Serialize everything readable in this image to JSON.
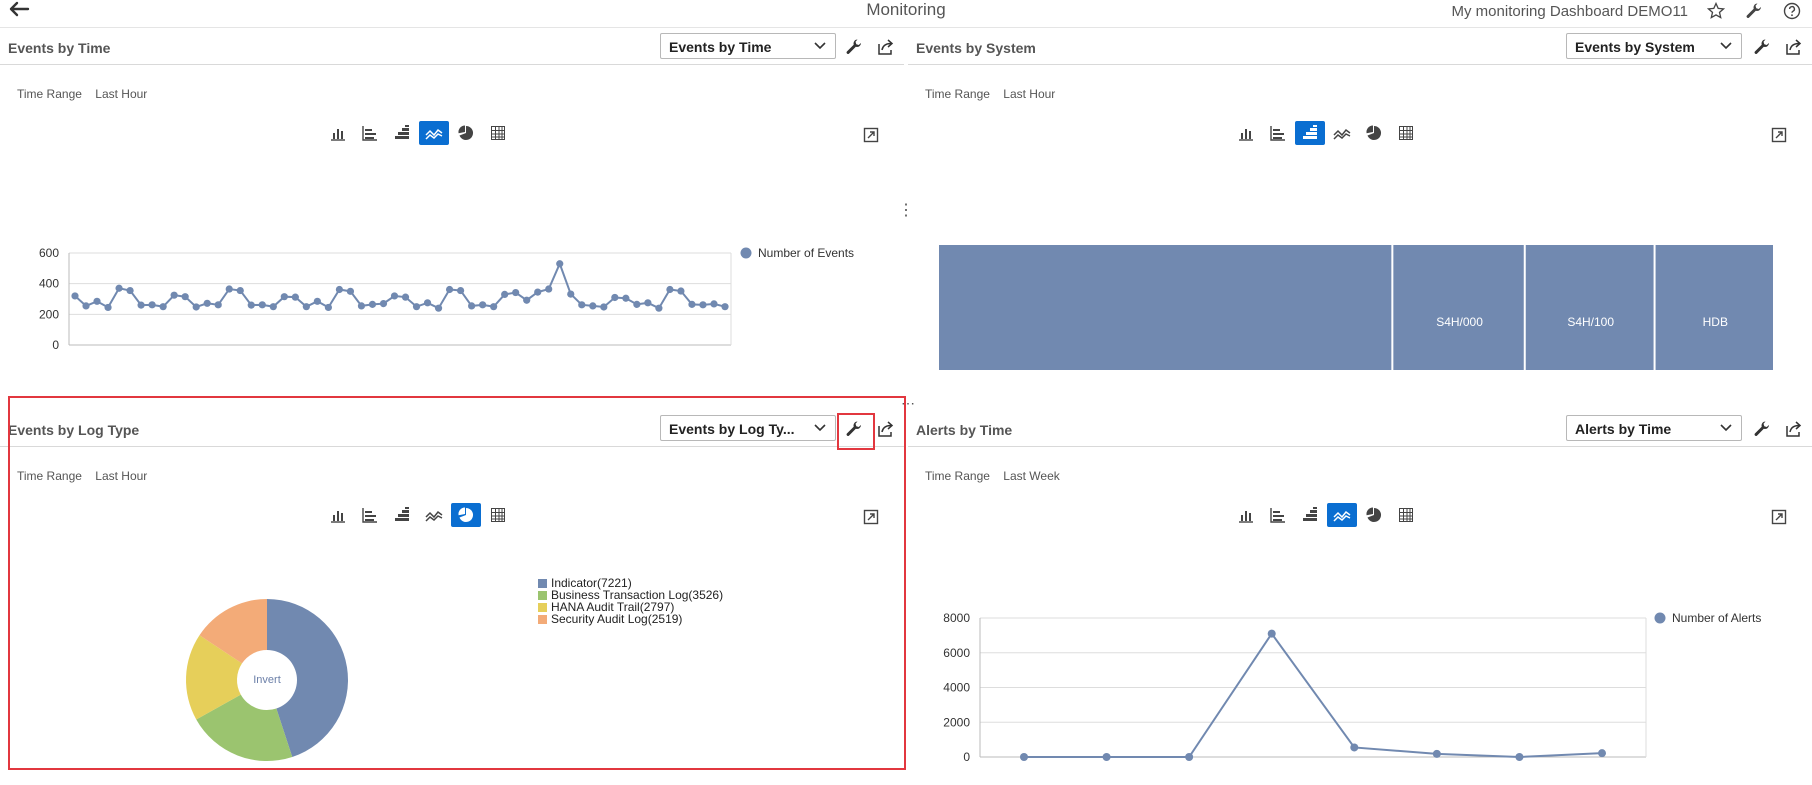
{
  "app": {
    "title": "Monitoring",
    "dashboard_name": "My monitoring Dashboard DEMO11",
    "icons": [
      "back-arrow-icon",
      "star-icon",
      "wrench-icon",
      "help-icon"
    ]
  },
  "panels": [
    {
      "title": "Events by Time",
      "select_value": "Events by Time",
      "time_range_label": "Time Range",
      "time_range_value": "Last Hour",
      "active_chart_type": "line"
    },
    {
      "title": "Events by System",
      "select_value": "Events by System",
      "time_range_label": "Time Range",
      "time_range_value": "Last Hour",
      "active_chart_type": "treemap"
    },
    {
      "title": "Events by Log Type",
      "select_value": "Events by Log Ty...",
      "time_range_label": "Time Range",
      "time_range_value": "Last Hour",
      "active_chart_type": "pie"
    },
    {
      "title": "Alerts by Time",
      "select_value": "Alerts by Time",
      "time_range_label": "Time Range",
      "time_range_value": "Last Week",
      "active_chart_type": "line"
    }
  ],
  "colors": {
    "accent": "#0a6ed1",
    "series": "#7189b0",
    "highlight": "#e2373f",
    "pie": [
      "#7189b0",
      "#9bc46f",
      "#e6cf5a",
      "#f3ab78"
    ]
  },
  "chart_data": [
    {
      "type": "line",
      "title": "Events by Time",
      "legend": [
        "Number of Events"
      ],
      "legend_position": "top-right",
      "ylim": [
        0,
        600
      ],
      "yticks": [
        0,
        200,
        400,
        600
      ],
      "grid": true,
      "series": [
        {
          "name": "Number of Events",
          "values": [
            320,
            255,
            285,
            245,
            370,
            355,
            260,
            262,
            250,
            325,
            315,
            248,
            272,
            262,
            365,
            355,
            260,
            262,
            250,
            315,
            312,
            250,
            285,
            245,
            362,
            350,
            255,
            265,
            270,
            320,
            312,
            250,
            275,
            240,
            362,
            355,
            255,
            262,
            250,
            330,
            342,
            292,
            345,
            365,
            530,
            332,
            262,
            255,
            248,
            310,
            305,
            265,
            275,
            240,
            362,
            352,
            265,
            262,
            268,
            250
          ]
        }
      ]
    },
    {
      "type": "treemap",
      "title": "Events by System",
      "categories": [
        "",
        "S4H/000",
        "S4H/100",
        "HDB"
      ],
      "values": [
        7000,
        2040,
        2000,
        1840
      ]
    },
    {
      "type": "pie",
      "title": "Events by Log Type",
      "center_label": "Invert",
      "legend_position": "top-right",
      "categories": [
        "Indicator",
        "Business Transaction Log",
        "HANA Audit Trail",
        "Security Audit Log"
      ],
      "values": [
        7221,
        3526,
        2797,
        2519
      ],
      "legend_labels": [
        "Indicator(7221)",
        "Business Transaction Log(3526)",
        "HANA Audit Trail(2797)",
        "Security Audit Log(2519)"
      ]
    },
    {
      "type": "line",
      "title": "Alerts by Time",
      "legend": [
        "Number of Alerts"
      ],
      "legend_position": "top-right",
      "ylim": [
        0,
        8000
      ],
      "yticks": [
        0,
        2000,
        4000,
        6000,
        8000
      ],
      "grid": true,
      "series": [
        {
          "name": "Number of Alerts",
          "values": [
            0,
            0,
            0,
            7100,
            550,
            180,
            0,
            220
          ]
        }
      ]
    }
  ]
}
